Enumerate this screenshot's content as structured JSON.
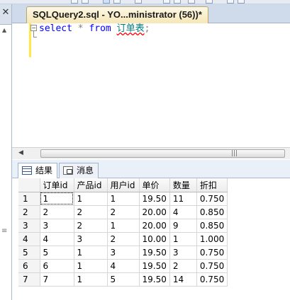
{
  "document_tab": {
    "title": "SQLQuery2.sql - YO...ministrator (56))*"
  },
  "editor": {
    "keyword_select": "select",
    "star": "*",
    "keyword_from": "from",
    "table_name": "订单表",
    "terminator": ";"
  },
  "results": {
    "tabs": [
      {
        "label": "结果",
        "icon": "grid-icon",
        "active": true
      },
      {
        "label": "消息",
        "icon": "messages-icon",
        "active": false
      }
    ],
    "columns": [
      "订单id",
      "产品id",
      "用户id",
      "单价",
      "数量",
      "折扣"
    ],
    "rows": [
      {
        "n": "1",
        "cells": [
          "1",
          "1",
          "1",
          "19.50",
          "11",
          "0.750"
        ]
      },
      {
        "n": "2",
        "cells": [
          "2",
          "2",
          "2",
          "20.00",
          "4",
          "0.850"
        ]
      },
      {
        "n": "3",
        "cells": [
          "3",
          "2",
          "1",
          "20.00",
          "9",
          "0.850"
        ]
      },
      {
        "n": "4",
        "cells": [
          "4",
          "3",
          "2",
          "10.00",
          "1",
          "1.000"
        ]
      },
      {
        "n": "5",
        "cells": [
          "5",
          "1",
          "3",
          "19.50",
          "3",
          "0.750"
        ]
      },
      {
        "n": "6",
        "cells": [
          "6",
          "1",
          "4",
          "19.50",
          "2",
          "0.750"
        ]
      },
      {
        "n": "7",
        "cells": [
          "7",
          "1",
          "5",
          "19.50",
          "14",
          "0.750"
        ]
      }
    ]
  },
  "left_gutter": {
    "close_glyph": "✕"
  },
  "colors": {
    "keyword": "#0000ff",
    "table": "#008080",
    "tab_active": "#f5e6b5"
  }
}
